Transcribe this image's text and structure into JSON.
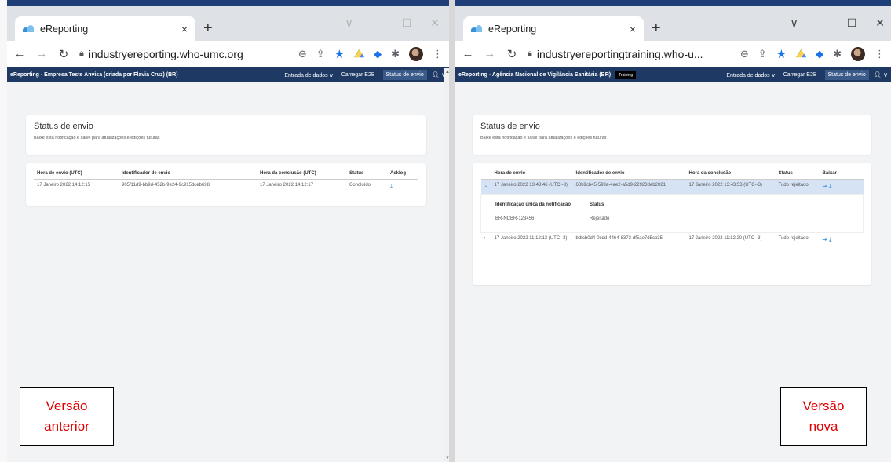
{
  "left": {
    "tab_title": "eReporting",
    "tab_close": "×",
    "new_tab": "+",
    "url": "industryereporting.who-umc.org",
    "app_brand": "eReporting - Empresa Teste Anvisa (criada por Flavia Cruz) (BR)",
    "menu": [
      "Entrada de dados",
      "Carregar E2B",
      "Status de envio"
    ],
    "page_title": "Status de envio",
    "page_subtitle": "Baixe esta notificação e salve para atualizações e edições futuras",
    "table_headers": [
      "Hora de envio (UTC)",
      "Identificador de envio",
      "Hora da conclusão (UTC)",
      "Status",
      "Acklog"
    ],
    "rows": [
      {
        "send_time": "17 Janeiro 2022 14:12:15",
        "id": "905f11d9-bb9d-452b-9e24-9c915dceb698",
        "done_time": "17 Janeiro 2022 14:12:17",
        "status": "Concluído"
      }
    ],
    "version_label": [
      "Versão",
      "anterior"
    ]
  },
  "right": {
    "tab_title": "eReporting",
    "tab_close": "×",
    "new_tab": "+",
    "url": "industryereportingtraining.who-u...",
    "app_brand": "eReporting - Agência Nacional de Vigilância Sanitária (BR)",
    "training_badge": "Training",
    "menu": [
      "Entrada de dados",
      "Carregar E2B",
      "Status de envio"
    ],
    "page_title": "Status de envio",
    "page_subtitle": "Baixe esta notificação e salve para atualizações e edições futuras",
    "table_headers": [
      "Hora de envio",
      "Identificador de envio",
      "Hora da conclusão",
      "Status",
      "Baixar"
    ],
    "rows": [
      {
        "send_time": "17 Janeiro 2022 13:43:46 (UTC--3)",
        "id": "60b9cb45-599a-4ae2-a5d9-22923deb2021",
        "done_time": "17 Janeiro 2022 13:43:53 (UTC--3)",
        "status": "Tudo rejeitado"
      },
      {
        "send_time": "17 Janeiro 2022 11:12:13 (UTC--3)",
        "id": "bdfcb0d4-0cdd-4464-8373-df5ae7d5cb35",
        "done_time": "17 Janeiro 2022 11:12:20 (UTC--3)",
        "status": "Tudo rejeitado"
      }
    ],
    "detail": {
      "headers": [
        "Identificação única da notificação",
        "Status"
      ],
      "values": [
        "BR-NCBR-123456",
        "Rejeitado"
      ]
    },
    "version_label": [
      "Versão",
      "nova"
    ]
  },
  "colors": {
    "appbar": "#1e3a64",
    "accent": "#1a73e8",
    "label_text": "#e00000",
    "selected_row": "#d6e3f5"
  }
}
